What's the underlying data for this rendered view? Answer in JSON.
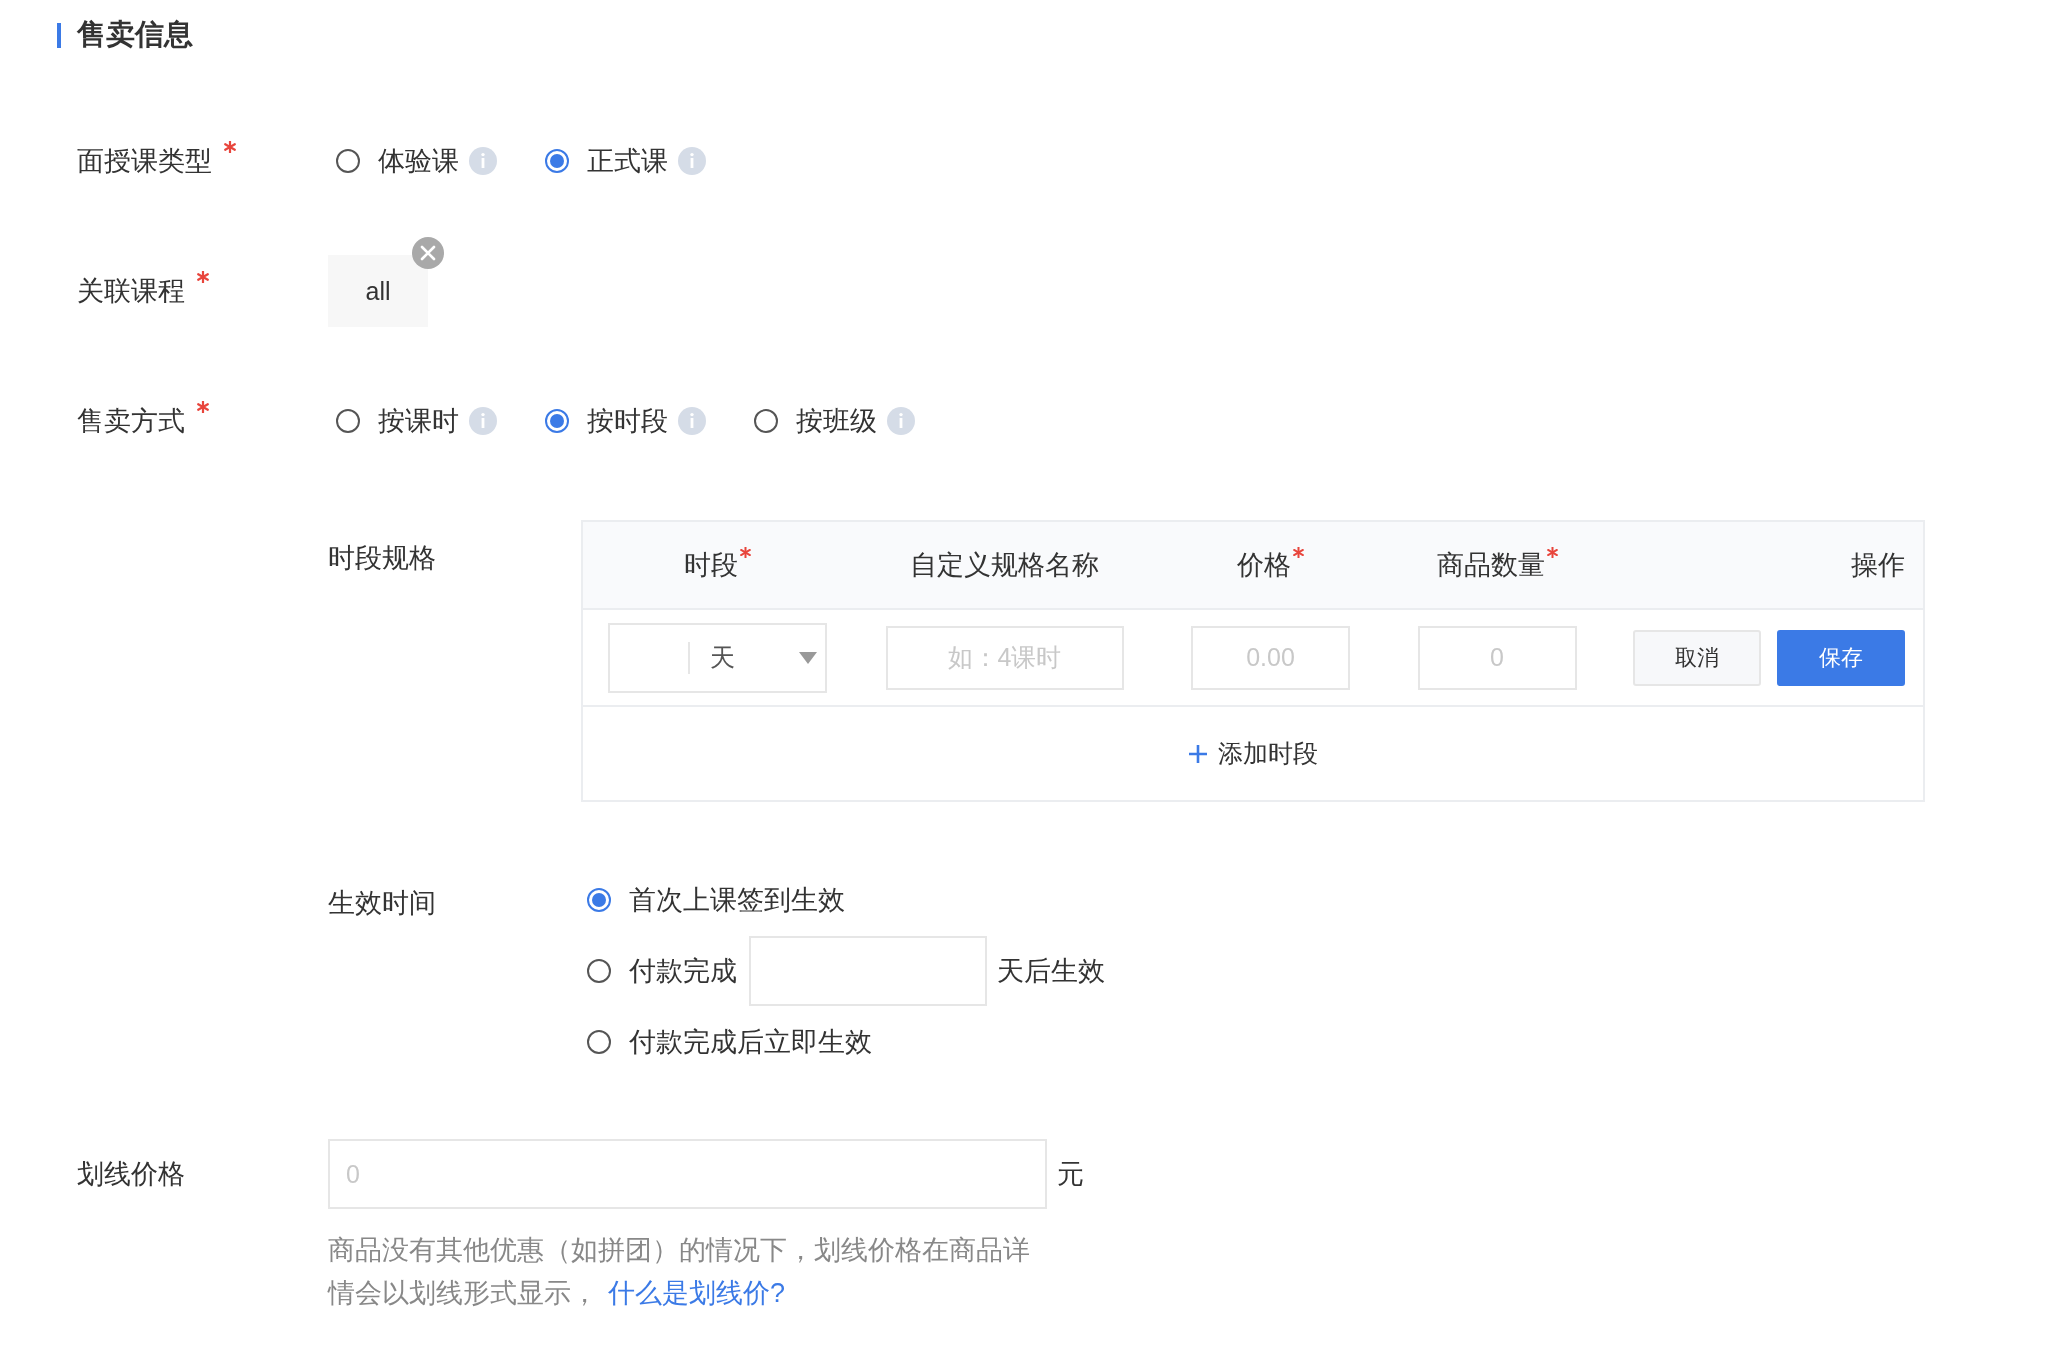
{
  "section": {
    "title": "售卖信息"
  },
  "fields": [
    {
      "kind": "radio",
      "label": "面授课类型",
      "required": true,
      "options": [
        {
          "label": "体验课",
          "selected": false,
          "info": true
        },
        {
          "label": "正式课",
          "selected": true,
          "info": true
        }
      ]
    },
    {
      "kind": "tags",
      "label": "关联课程",
      "required": true,
      "tags": [
        {
          "text": "all",
          "removable": true
        }
      ]
    },
    {
      "kind": "radio",
      "label": "售卖方式",
      "required": true,
      "options": [
        {
          "label": "按课时",
          "selected": false,
          "info": true
        },
        {
          "label": "按时段",
          "selected": true,
          "info": true
        },
        {
          "label": "按班级",
          "selected": false,
          "info": true
        }
      ]
    }
  ],
  "spec_table": {
    "label": "时段规格",
    "columns": [
      {
        "title": "时段",
        "required": true
      },
      {
        "title": "自定义规格名称",
        "required": false
      },
      {
        "title": "价格",
        "required": true
      },
      {
        "title": "商品数量",
        "required": true
      },
      {
        "title": "操作",
        "required": false
      }
    ],
    "rows": [
      {
        "unit": "天",
        "name_placeholder": "如：4课时",
        "price_placeholder": "0.00",
        "quantity_placeholder": "0",
        "cancel": "取消",
        "save": "保存"
      }
    ],
    "add_button": "添加时段"
  },
  "effective": {
    "label": "生效时间",
    "options": [
      {
        "label": "首次上课签到生效",
        "selected": true
      },
      {
        "label": "付款完成",
        "suffix": "天后生效",
        "selected": false
      },
      {
        "label": "付款完成后立即生效",
        "selected": false
      }
    ]
  },
  "strike_price": {
    "label": "划线价格",
    "placeholder": "0",
    "unit": "元",
    "help": "商品没有其他优惠（如拼团）的情况下，划线价格在商品详情会以划线形式显示，",
    "link": "什么是划线价?"
  }
}
